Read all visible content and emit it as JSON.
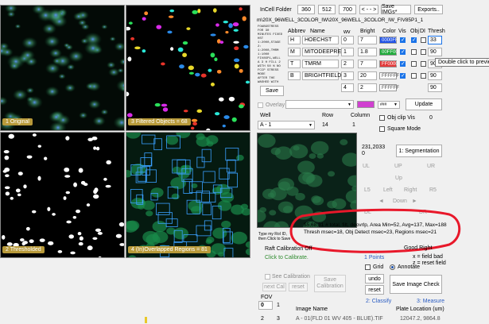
{
  "panels": {
    "original": "1 Original",
    "filtered": "3 Filtered Objects = 68",
    "thresholded": "2 Thresholded",
    "regions": "4 (In)Overlapped Regions = 81"
  },
  "top_bar": {
    "folder_label": "InCell Folder",
    "size_1": "360",
    "size_2": "512",
    "size_3": "700",
    "arrows": "< - - >",
    "save_imgs": "Save IMGs*",
    "exports": "Exports..",
    "path": "m\\20X_96WELL_3COLOR_IW\\20X_96WELL_3COLOR_IW_FIV85P1_1"
  },
  "channel_table": {
    "headers": {
      "abbrev": "Abbrev",
      "name": "Name",
      "wv": "wv",
      "bright": "Bright",
      "color": "Color",
      "vis": "Vis",
      "obj": "Obj",
      "di": "DI",
      "thresh": "Thresh"
    },
    "rows": [
      {
        "abbrev": "H",
        "name": "HOECHST",
        "wv": "0",
        "bright": "7",
        "color": "0000FF",
        "color_hex": "#1f52e6",
        "thresh": "33"
      },
      {
        "abbrev": "M",
        "name": "MITODEEPRED",
        "wv": "1",
        "bright": "1.8",
        "color": "00FF00",
        "color_hex": "#1faa3a",
        "thresh": "90"
      },
      {
        "abbrev": "T",
        "name": "TMRM",
        "wv": "2",
        "bright": "7",
        "color": "FF0000",
        "color_hex": "#e23a3a",
        "thresh": "90"
      },
      {
        "abbrev": "B",
        "name": "BRIGHTFIELD",
        "wv": "3",
        "bright": "20",
        "color": "FFFFFF",
        "color_hex": "#ffffff",
        "thresh": "90"
      },
      {
        "abbrev": "",
        "name": "",
        "wv": "4",
        "bright": "2",
        "color": "FFFFFF",
        "color_hex": "#ffffff",
        "thresh": "90"
      }
    ],
    "extra_swatch": "",
    "extra_dropdown": "###",
    "info_text": "FOABGSTRESS\nFOR 30\nMINUTES FIXED\nHST\n1:2000,STAGE\n2:\n1:2000,TMRM\n1:1000\nFIV85P1,WELL\nA 3 H FILL 2\nWITH 50 % NO\nFCCP STRESS\nMODE\nAFTER THE\nWASHED WITH"
  },
  "controls": {
    "save": "Save",
    "overlay": "Overlay",
    "update": "Update",
    "well_label": "Well",
    "row_label": "Row",
    "column_label": "Column",
    "well_value": "A - 1",
    "row_value": "14",
    "column_value": "1",
    "obj_clip_vis": "Obj clip Vis",
    "obj_clip_value": "0",
    "square_mode": "Square Mode",
    "coords": "231,2033\n0",
    "segmentation": "1: Segmentation",
    "nav": {
      "ul": "UL",
      "up": "UP",
      "ur": "UR",
      "up_small": "Up",
      "l5": "L5",
      "left": "Left",
      "right": "Right",
      "r5": "R5",
      "down": "Down",
      "dl": "DL",
      "dr": "DR"
    },
    "roi_hint": "Type my RoI ID,\nthen Click to Save",
    "tooltip": "Double click to preview"
  },
  "stats": {
    "line1": "$5,68,31 # total, filt, deovrlp, Area Min=52, Avg=137, Max=188",
    "line2": "Thresh msec=18, Obj Detect msec=23, Regions msec=21"
  },
  "bottom_left": {
    "raft_calibration": "Raft Calibration Off",
    "click_calibrate": "Click to Calibrate.",
    "see_calibration": "See Calibration",
    "next_cal": "next Cal",
    "reset": "reset",
    "save_calibration": "Save\nCalibration",
    "fov_label": "FOV",
    "fov_value": "0",
    "fov_next": "1",
    "row_n1": "2",
    "row_n2": "3"
  },
  "bottom_right": {
    "good_right": "Good  Right",
    "points": "1 Points",
    "field_bad": "x = field bad",
    "reset_field": "z = reset field",
    "grid": "Grid",
    "annotate": "Annotate",
    "undo": "undo",
    "reset": "reset",
    "save_image_check": "Save Image Check",
    "classify": "2: Classify",
    "measure": "3: Measure"
  },
  "bottom_table": {
    "image_name_header": "Image Name",
    "plate_location_header": "Plate Location (um)",
    "image_name_value": "A - 01(FLD 01 WV 405 - BLUE).TIF",
    "plate_location_value": "12047.2, 9864.8"
  }
}
